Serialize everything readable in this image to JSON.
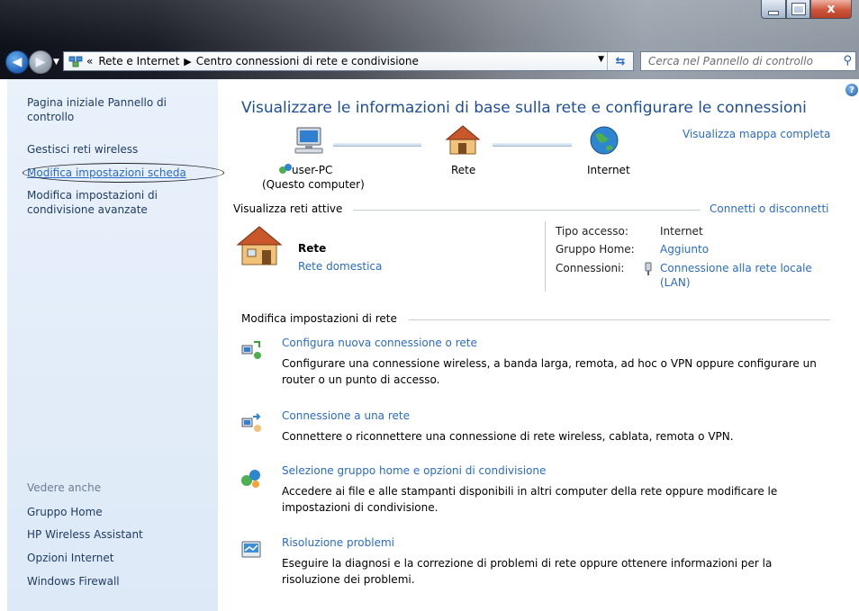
{
  "window": {
    "buttons": {
      "minimize": "–",
      "maximize": "□",
      "close": "x"
    }
  },
  "nav": {
    "breadcrumb_prefix": "«",
    "crumbs": [
      "Rete e Internet",
      "Centro connessioni di rete e condivisione"
    ],
    "search_placeholder": "Cerca nel Pannello di controllo"
  },
  "sidebar": {
    "items": [
      {
        "label": "Pagina iniziale Pannello di controllo"
      },
      {
        "label": "Gestisci reti wireless"
      },
      {
        "label": "Modifica impostazioni scheda"
      },
      {
        "label": "Modifica impostazioni di condivisione avanzate"
      }
    ],
    "see_also_title": "Vedere anche",
    "see_also": [
      {
        "label": "Gruppo Home"
      },
      {
        "label": "HP Wireless Assistant"
      },
      {
        "label": "Opzioni Internet"
      },
      {
        "label": "Windows Firewall"
      }
    ]
  },
  "main": {
    "title": "Visualizzare le informazioni di base sulla rete e configurare le connessioni",
    "full_map_link": "Visualizza mappa completa",
    "map": {
      "computer_name": "user-PC",
      "computer_note": "(Questo computer)",
      "network": "Rete",
      "internet": "Internet"
    },
    "active_networks": {
      "header": "Visualizza reti attive",
      "connect_link": "Connetti o disconnetti",
      "network_name": "Rete",
      "network_type": "Rete domestica",
      "access_type_label": "Tipo accesso:",
      "access_type_value": "Internet",
      "homegroup_label": "Gruppo Home:",
      "homegroup_value": "Aggiunto",
      "connections_label": "Connessioni:",
      "connections_value_line1": "Connessione alla rete locale",
      "connections_value_line2": "(LAN)"
    },
    "settings_header": "Modifica impostazioni di rete",
    "tasks": [
      {
        "title": "Configura nuova connessione o rete",
        "desc": "Configurare una connessione wireless, a banda larga, remota, ad hoc o VPN oppure configurare un router o un punto di accesso."
      },
      {
        "title": "Connessione a una rete",
        "desc": "Connettere o riconnettere una connessione di rete wireless, cablata, remota o VPN."
      },
      {
        "title": "Selezione gruppo home e opzioni di condivisione",
        "desc": "Accedere ai file e alle stampanti disponibili in altri computer della rete oppure modificare le impostazioni di condivisione."
      },
      {
        "title": "Risoluzione problemi",
        "desc": "Eseguire la diagnosi e la correzione di problemi di rete oppure ottenere informazioni per la risoluzione dei problemi."
      }
    ]
  }
}
